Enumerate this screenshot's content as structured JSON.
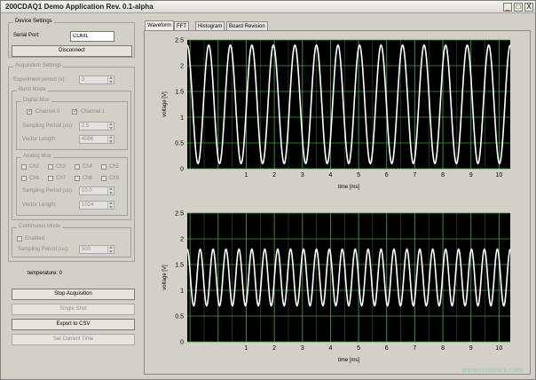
{
  "window": {
    "title": "200CDAQ1 Demo Application Rev. 0.1-alpha",
    "minimize": "_",
    "maximize": "□",
    "close": "X"
  },
  "device": {
    "group_label": "Device Settings",
    "serial_port_label": "Serial Port:",
    "serial_port_value": "COM1",
    "disconnect": "Disconnect"
  },
  "acquisition": {
    "group_label": "Acquisition Settings",
    "experiment_period_label": "Experiment period (s):",
    "experiment_period_value": "3",
    "burst_label": "Burst Mode",
    "digital_mux": {
      "label": "Digital Mux",
      "channel0": "Channel 0",
      "channel1": "Channel 1",
      "sampling_label": "Sampling Period (us):",
      "sampling_value": "2.5",
      "vector_label": "Vector Length:",
      "vector_value": "4096"
    },
    "analog_mux": {
      "label": "Analog Mux",
      "channels": [
        "Ch2",
        "Ch3",
        "Ch4",
        "Ch5",
        "Ch6",
        "Ch7",
        "Ch8",
        "Ch9"
      ],
      "sampling_label": "Sampling Period (us):",
      "sampling_value": "10.0",
      "vector_label": "Vector Length:",
      "vector_value": "1024"
    },
    "continuous": {
      "label": "Continuous Mode",
      "enabled": "Enabled",
      "sampling_label": "Sampling Period (us):",
      "sampling_value": "500"
    }
  },
  "temperature": "temperature: 0",
  "buttons": {
    "stop": "Stop Acquisition",
    "single": "Single Shot",
    "export": "Export to CSV",
    "set_time": "Set Current Time"
  },
  "tabs": [
    "Waveform",
    "FFT",
    "Histogram",
    "Board Revision"
  ],
  "colors": {
    "plot_bg": "#000000",
    "grid": "#3f9a3f",
    "trace": "#ffffff"
  },
  "chart_data": [
    {
      "type": "line",
      "xlabel": "time [ms]",
      "ylabel": "voltage [V]",
      "xlim": [
        -1.1,
        10.4
      ],
      "ylim": [
        0,
        2.5
      ],
      "xticks": [
        1,
        2,
        3,
        4,
        5,
        6,
        7,
        8,
        9,
        10
      ],
      "yticks": [
        "0",
        "0.5",
        "1",
        "1.5",
        "2",
        "2.5"
      ],
      "series": [
        {
          "kind": "sine",
          "offset": 1.25,
          "amplitude": 1.15,
          "cycles": 15
        }
      ]
    },
    {
      "type": "line",
      "xlabel": "time [ms]",
      "ylabel": "voltage [V]",
      "xlim": [
        -1.1,
        10.4
      ],
      "ylim": [
        0,
        2.5
      ],
      "xticks": [
        1,
        2,
        3,
        4,
        5,
        6,
        7,
        8,
        9,
        10
      ],
      "yticks": [
        "0",
        "0.5",
        "1",
        "1.5",
        "2",
        "2.5"
      ],
      "series": [
        {
          "kind": "sine",
          "offset": 1.25,
          "amplitude": 0.55,
          "cycles": 25
        }
      ]
    }
  ],
  "watermark": "www.cntronics.com"
}
